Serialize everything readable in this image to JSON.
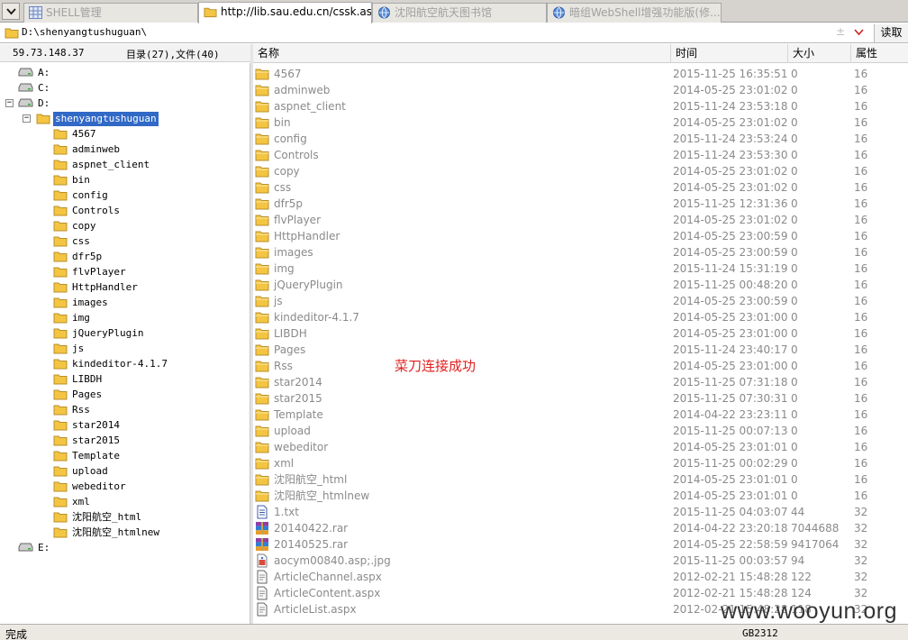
{
  "tabs": [
    {
      "label": "SHELL管理",
      "icon": "grid-icon",
      "active": false
    },
    {
      "label": "http://lib.sau.edu.cn/cssk.asp;jpg",
      "icon": "folder-icon",
      "active": true
    },
    {
      "label": "沈阳航空航天图书馆",
      "icon": "globe-icon",
      "active": false
    },
    {
      "label": "暗组WebShell增强功能版(修...",
      "icon": "globe-icon",
      "active": false
    }
  ],
  "address": {
    "path": "D:\\shenyangtushuguan\\",
    "extra": "±",
    "read_label": "读取"
  },
  "info": {
    "ip": "59.73.148.37",
    "count": "目录(27),文件(40)"
  },
  "drives": {
    "a": "A:",
    "c": "C:",
    "d": "D:",
    "e": "E:"
  },
  "tree": {
    "root": "shenyangtushuguan",
    "children": [
      "4567",
      "adminweb",
      "aspnet_client",
      "bin",
      "config",
      "Controls",
      "copy",
      "css",
      "dfr5p",
      "flvPlayer",
      "HttpHandler",
      "images",
      "img",
      "jQueryPlugin",
      "js",
      "kindeditor-4.1.7",
      "LIBDH",
      "Pages",
      "Rss",
      "star2014",
      "star2015",
      "Template",
      "upload",
      "webeditor",
      "xml",
      "沈阳航空_html",
      "沈阳航空_htmlnew"
    ]
  },
  "columns": {
    "name": "名称",
    "time": "时间",
    "size": "大小",
    "attr": "属性"
  },
  "files": [
    {
      "name": "4567",
      "time": "2015-11-25 16:35:51",
      "size": "0",
      "attr": "16",
      "icon": "folder-icon"
    },
    {
      "name": "adminweb",
      "time": "2014-05-25 23:01:02",
      "size": "0",
      "attr": "16",
      "icon": "folder-icon"
    },
    {
      "name": "aspnet_client",
      "time": "2015-11-24 23:53:18",
      "size": "0",
      "attr": "16",
      "icon": "folder-icon"
    },
    {
      "name": "bin",
      "time": "2014-05-25 23:01:02",
      "size": "0",
      "attr": "16",
      "icon": "folder-icon"
    },
    {
      "name": "config",
      "time": "2015-11-24 23:53:24",
      "size": "0",
      "attr": "16",
      "icon": "folder-icon"
    },
    {
      "name": "Controls",
      "time": "2015-11-24 23:53:30",
      "size": "0",
      "attr": "16",
      "icon": "folder-icon"
    },
    {
      "name": "copy",
      "time": "2014-05-25 23:01:02",
      "size": "0",
      "attr": "16",
      "icon": "folder-icon"
    },
    {
      "name": "css",
      "time": "2014-05-25 23:01:02",
      "size": "0",
      "attr": "16",
      "icon": "folder-icon"
    },
    {
      "name": "dfr5p",
      "time": "2015-11-25 12:31:36",
      "size": "0",
      "attr": "16",
      "icon": "folder-icon"
    },
    {
      "name": "flvPlayer",
      "time": "2014-05-25 23:01:02",
      "size": "0",
      "attr": "16",
      "icon": "folder-icon"
    },
    {
      "name": "HttpHandler",
      "time": "2014-05-25 23:00:59",
      "size": "0",
      "attr": "16",
      "icon": "folder-icon"
    },
    {
      "name": "images",
      "time": "2014-05-25 23:00:59",
      "size": "0",
      "attr": "16",
      "icon": "folder-icon"
    },
    {
      "name": "img",
      "time": "2015-11-24 15:31:19",
      "size": "0",
      "attr": "16",
      "icon": "folder-icon"
    },
    {
      "name": "jQueryPlugin",
      "time": "2015-11-25 00:48:20",
      "size": "0",
      "attr": "16",
      "icon": "folder-icon"
    },
    {
      "name": "js",
      "time": "2014-05-25 23:00:59",
      "size": "0",
      "attr": "16",
      "icon": "folder-icon"
    },
    {
      "name": "kindeditor-4.1.7",
      "time": "2014-05-25 23:01:00",
      "size": "0",
      "attr": "16",
      "icon": "folder-icon"
    },
    {
      "name": "LIBDH",
      "time": "2014-05-25 23:01:00",
      "size": "0",
      "attr": "16",
      "icon": "folder-icon"
    },
    {
      "name": "Pages",
      "time": "2015-11-24 23:40:17",
      "size": "0",
      "attr": "16",
      "icon": "folder-icon"
    },
    {
      "name": "Rss",
      "time": "2014-05-25 23:01:00",
      "size": "0",
      "attr": "16",
      "icon": "folder-icon"
    },
    {
      "name": "star2014",
      "time": "2015-11-25 07:31:18",
      "size": "0",
      "attr": "16",
      "icon": "folder-icon"
    },
    {
      "name": "star2015",
      "time": "2015-11-25 07:30:31",
      "size": "0",
      "attr": "16",
      "icon": "folder-icon"
    },
    {
      "name": "Template",
      "time": "2014-04-22 23:23:11",
      "size": "0",
      "attr": "16",
      "icon": "folder-icon"
    },
    {
      "name": "upload",
      "time": "2015-11-25 00:07:13",
      "size": "0",
      "attr": "16",
      "icon": "folder-icon"
    },
    {
      "name": "webeditor",
      "time": "2014-05-25 23:01:01",
      "size": "0",
      "attr": "16",
      "icon": "folder-icon"
    },
    {
      "name": "xml",
      "time": "2015-11-25 00:02:29",
      "size": "0",
      "attr": "16",
      "icon": "folder-icon"
    },
    {
      "name": "沈阳航空_html",
      "time": "2014-05-25 23:01:01",
      "size": "0",
      "attr": "16",
      "icon": "folder-icon"
    },
    {
      "name": "沈阳航空_htmlnew",
      "time": "2014-05-25 23:01:01",
      "size": "0",
      "attr": "16",
      "icon": "folder-icon"
    },
    {
      "name": "1.txt",
      "time": "2015-11-25 04:03:07",
      "size": "44",
      "attr": "32",
      "icon": "text-file-icon"
    },
    {
      "name": "20140422.rar",
      "time": "2014-04-22 23:20:18",
      "size": "7044688",
      "attr": "32",
      "icon": "rar-archive-icon"
    },
    {
      "name": "20140525.rar",
      "time": "2014-05-25 22:58:59",
      "size": "9417064",
      "attr": "32",
      "icon": "rar-archive-icon"
    },
    {
      "name": "aocym00840.asp;.jpg",
      "time": "2015-11-25 00:03:57",
      "size": "94",
      "attr": "32",
      "icon": "image-file-icon"
    },
    {
      "name": "ArticleChannel.aspx",
      "time": "2012-02-21 15:48:28",
      "size": "122",
      "attr": "32",
      "icon": "document-icon"
    },
    {
      "name": "ArticleContent.aspx",
      "time": "2012-02-21 15:48:28",
      "size": "124",
      "attr": "32",
      "icon": "document-icon"
    },
    {
      "name": "ArticleList.aspx",
      "time": "2012-02-21 15:48:28",
      "size": "118",
      "attr": "32",
      "icon": "document-icon"
    }
  ],
  "overlay_message": "菜刀连接成功",
  "status": {
    "text": "完成",
    "encoding": "GB2312"
  },
  "watermark": "www.wooyun.org",
  "colors": {
    "selection": "#3169c6",
    "folder": "#f4c542",
    "message": "#e0201e"
  }
}
